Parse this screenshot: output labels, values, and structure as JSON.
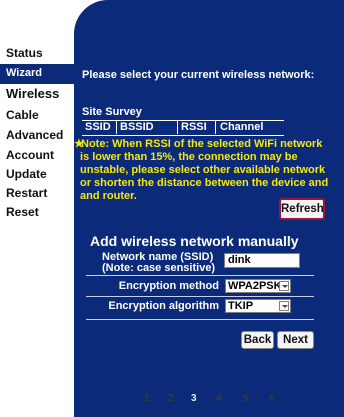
{
  "sidebar": {
    "items": [
      {
        "label": "Status"
      },
      {
        "label": "Wizard"
      },
      {
        "label": "Wireless"
      },
      {
        "label": "Cable"
      },
      {
        "label": "Advanced"
      },
      {
        "label": "Account"
      },
      {
        "label": "Update"
      },
      {
        "label": "Restart"
      },
      {
        "label": "Reset"
      }
    ]
  },
  "main": {
    "heading": "Please select your current wireless network:",
    "site_survey": {
      "title": "Site Survey",
      "columns": [
        "SSID",
        "BSSID",
        "RSSI",
        "Channel"
      ]
    },
    "note": {
      "star": "★",
      "lines": [
        "Note: When RSSI of the selected WiFi network",
        "is lower than 15%, the connection may be",
        "unstable, please select other available network",
        "or shorten the distance between the device and",
        "and router."
      ]
    },
    "refresh_label": "Refresh",
    "add_title": "Add wireless network manually",
    "ssid": {
      "label_line1": "Network name (SSID)",
      "label_line2": "(Note: case sensitive)",
      "value": "dink"
    },
    "encryption_method": {
      "label": "Encryption method",
      "value": "WPA2PSK"
    },
    "encryption_algorithm": {
      "label": "Encryption algorithm",
      "value": "TKIP"
    },
    "back_label": "Back",
    "next_label": "Next",
    "pagination": {
      "pages": [
        "1",
        "2",
        "3",
        "4",
        "5",
        "6"
      ],
      "current": "3"
    }
  },
  "colors": {
    "panel": "#0b2a79",
    "note": "#f6e80f",
    "refresh_border": "#a0143a"
  }
}
